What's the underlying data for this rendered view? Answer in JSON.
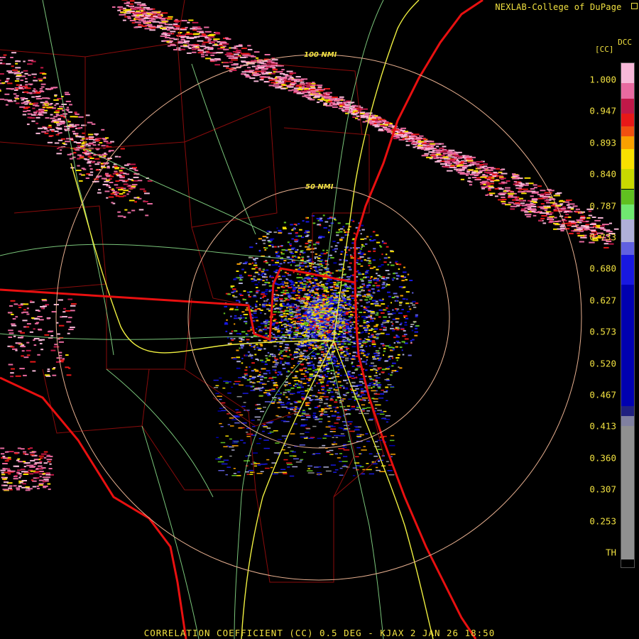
{
  "header": {
    "credit": "NEXLAB-College of DuPage",
    "product_code": "DCC",
    "unit": "[CC]"
  },
  "rings": {
    "inner_label": "50 NMI",
    "outer_label": "100 NMI"
  },
  "legend": {
    "ticks": [
      "1.000",
      "0.947",
      "0.893",
      "0.840",
      "0.787",
      "0.733",
      "0.680",
      "0.627",
      "0.573",
      "0.520",
      "0.467",
      "0.413",
      "0.360",
      "0.307",
      "0.253",
      "TH"
    ]
  },
  "footer": {
    "title": "CORRELATION COEFFICIENT (CC) 0.5 DEG - KJAX 2 JAN 26 18:50"
  },
  "colors": {
    "background": "#000000",
    "text": "#f0e040",
    "state_borders": "#e81010",
    "county_borders": "#8a0c0c",
    "roads": "#90e890",
    "interstates": "#f0f040",
    "range_rings": "#e8b090"
  }
}
